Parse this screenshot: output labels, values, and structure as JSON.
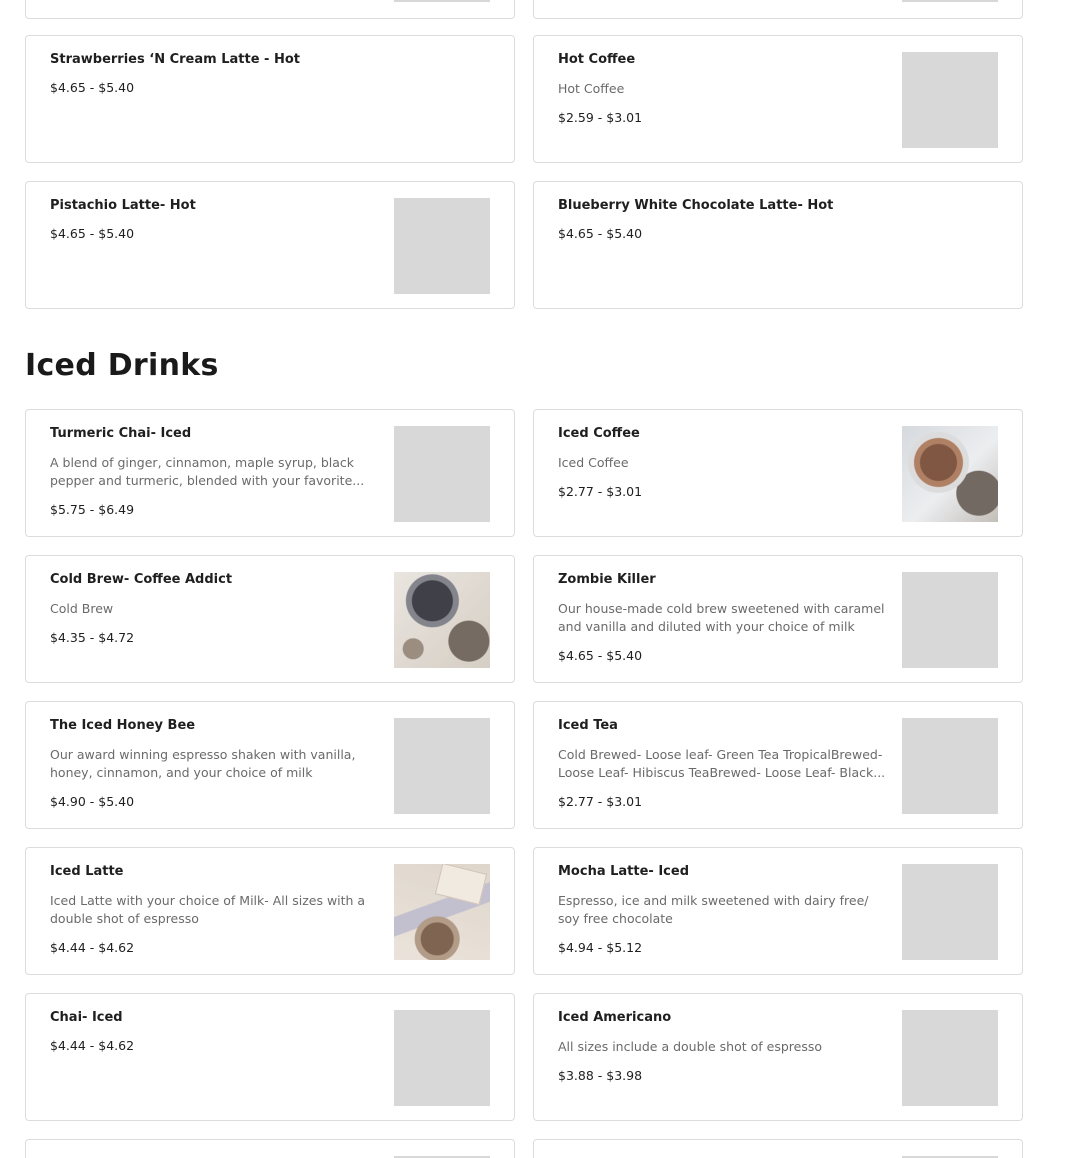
{
  "section": {
    "title": "Iced Drinks"
  },
  "hot_items": [
    {
      "name": "Strawberries ‘N Cream Latte - Hot",
      "description": "",
      "price": "$4.65 - $5.40",
      "image": "none"
    },
    {
      "name": "Hot Coffee",
      "description": "Hot Coffee",
      "price": "$2.59 - $3.01",
      "image": "placeholder"
    },
    {
      "name": "Pistachio Latte- Hot",
      "description": "",
      "price": "$4.65 - $5.40",
      "image": "placeholder"
    },
    {
      "name": "Blueberry White Chocolate Latte- Hot",
      "description": "",
      "price": "$4.65 - $5.40",
      "image": "none"
    }
  ],
  "iced_items": [
    {
      "name": "Turmeric Chai- Iced",
      "description": "A blend of ginger, cinnamon, maple syrup, black pepper and turmeric, blended with your favorite...",
      "price": "$5.75 - $6.49",
      "image": "placeholder"
    },
    {
      "name": "Iced Coffee",
      "description": "Iced Coffee",
      "price": "$2.77 - $3.01",
      "image": "iced-coffee-photo"
    },
    {
      "name": "Cold Brew- Coffee Addict",
      "description": "Cold Brew",
      "price": "$4.35 - $4.72",
      "image": "cold-brew-photo"
    },
    {
      "name": "Zombie Killer",
      "description": "Our house-made cold brew sweetened with caramel and vanilla and diluted with your choice of milk",
      "price": "$4.65 - $5.40",
      "image": "placeholder"
    },
    {
      "name": "The Iced Honey Bee",
      "description": "Our award winning espresso shaken with vanilla, honey, cinnamon, and your choice of milk",
      "price": "$4.90 - $5.40",
      "image": "placeholder"
    },
    {
      "name": "Iced Tea",
      "description": "Cold Brewed- Loose leaf- Green Tea TropicalBrewed- Loose Leaf- Hibiscus TeaBrewed- Loose Leaf- Black...",
      "price": "$2.77 - $3.01",
      "image": "placeholder"
    },
    {
      "name": "Iced Latte",
      "description": "Iced Latte with your choice of Milk- All sizes with a double shot of espresso",
      "price": "$4.44 - $4.62",
      "image": "iced-latte-photo"
    },
    {
      "name": "Mocha Latte- Iced",
      "description": "Espresso, ice and milk sweetened with dairy free/ soy free chocolate",
      "price": "$4.94 - $5.12",
      "image": "placeholder"
    },
    {
      "name": "Chai- Iced",
      "description": "",
      "price": "$4.44 - $4.62",
      "image": "placeholder"
    },
    {
      "name": "Iced Americano",
      "description": "All sizes include a double shot of espresso",
      "price": "$3.88 - $3.98",
      "image": "placeholder"
    }
  ],
  "colors": {
    "border": "#dcdcdc",
    "placeholder": "#d8d8d8",
    "text": "#1f1f1f",
    "muted": "#6a6a6a"
  }
}
